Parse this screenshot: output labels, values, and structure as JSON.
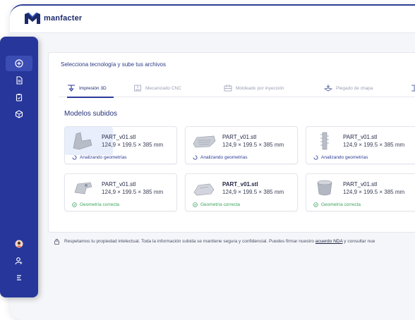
{
  "brand": {
    "name": "manfacter"
  },
  "sidebar": {
    "items": [
      {
        "icon": "add-circle-icon"
      },
      {
        "icon": "document-icon"
      },
      {
        "icon": "clipboard-icon"
      },
      {
        "icon": "cube-icon"
      },
      {
        "icon": "avatar"
      },
      {
        "icon": "user-key-icon"
      },
      {
        "icon": "menu-icon"
      }
    ]
  },
  "upload": {
    "title": "Selecciona tecnología y sube tus archivos",
    "tabs": [
      {
        "label": "Impresión 3D",
        "active": true
      },
      {
        "label": "Mecanizado CNC",
        "active": false
      },
      {
        "label": "Moldeado por inyección",
        "active": false
      },
      {
        "label": "Plegado de chapa",
        "active": false
      }
    ],
    "section_title": "Modelos subidos",
    "files": [
      {
        "name": "PART_v01.stl",
        "dims": "124,9 × 199.5 × 385 mm",
        "status": "Analizando geometrías",
        "state": "loading"
      },
      {
        "name": "PART_v01.stl",
        "dims": "124,9 × 199.5 × 385 mm",
        "status": "Analizando geometrías",
        "state": "loading"
      },
      {
        "name": "PART_v01.stl",
        "dims": "124,9 × 199.5 × 385 mm",
        "status": "Analizando geometrías",
        "state": "loading"
      },
      {
        "name": "PART_v01.stl",
        "dims": "124,9 × 199.5 × 385 mm",
        "status": "Geometría correcta",
        "state": "ok"
      },
      {
        "name": "PART_v01.stl",
        "dims": "124,9 × 199.5 × 385 mm",
        "status": "Geometría correcta",
        "state": "ok"
      },
      {
        "name": "PART_v01.stl",
        "dims": "124,9 × 199.5 × 385 mm",
        "status": "Geometría correcta",
        "state": "ok"
      }
    ]
  },
  "footer": {
    "text": "Respetamos tu propiedad intelectual. Toda la información subida se mantiene segura y confidencial. Puedes firmar nuestro",
    "link": "acuerdo NDA",
    "text_after": "y consultar nue"
  },
  "colors": {
    "primary": "#27369a",
    "success": "#3aa35a",
    "text": "#1d2a5a"
  }
}
